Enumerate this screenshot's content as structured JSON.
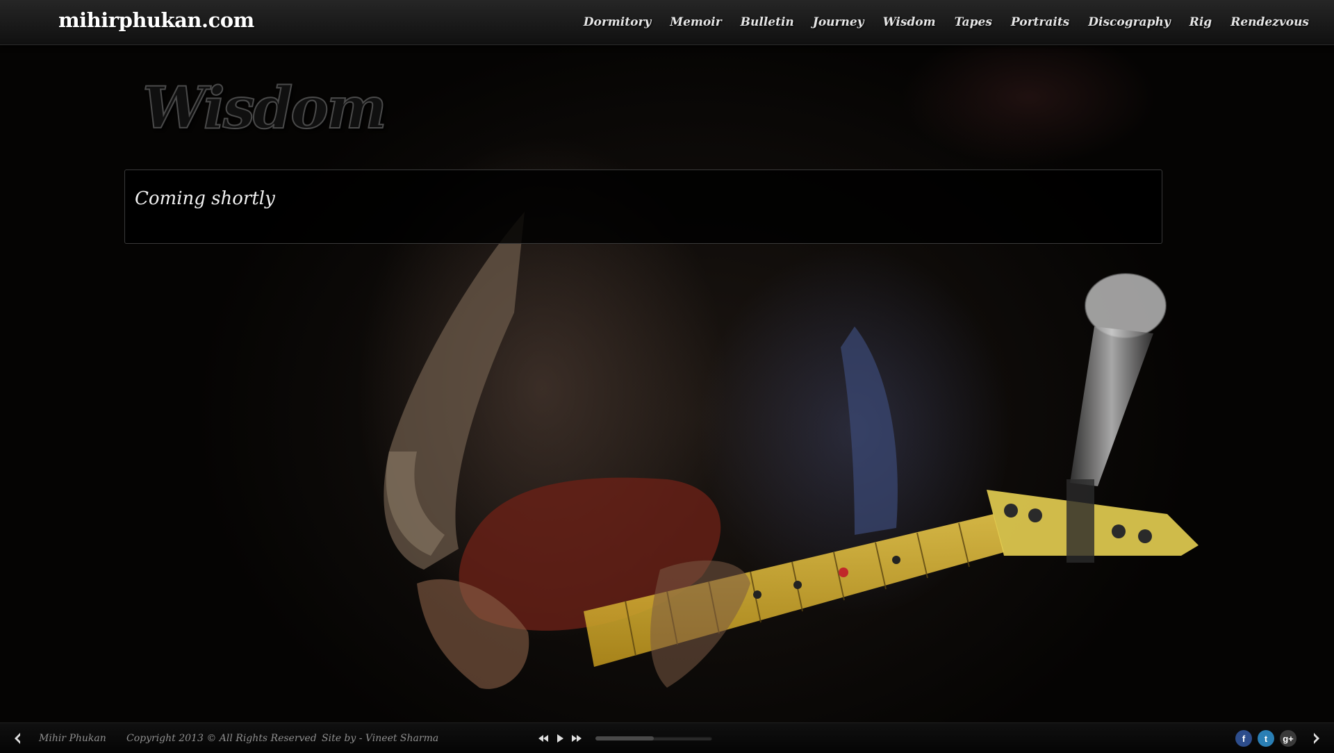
{
  "header": {
    "site_title": "mihirphukan.com",
    "nav": [
      "Dormitory",
      "Memoir",
      "Bulletin",
      "Journey",
      "Wisdom",
      "Tapes",
      "Portraits",
      "Discography",
      "Rig",
      "Rendezvous"
    ]
  },
  "page": {
    "title": "Wisdom",
    "content": "Coming shortly"
  },
  "footer": {
    "name": "Mihir Phukan",
    "copyright": "Copyright 2013 © All Rights Reserved",
    "credit": "Site by - Vineet Sharma",
    "player_progress": 0.5,
    "social": [
      {
        "icon": "facebook-icon",
        "glyph": "f",
        "color": "#2d4d8c"
      },
      {
        "icon": "twitter-icon",
        "glyph": "t",
        "color": "#2a7fb5"
      },
      {
        "icon": "google-plus-icon",
        "glyph": "g+",
        "color": "#3a3a3a"
      }
    ]
  }
}
